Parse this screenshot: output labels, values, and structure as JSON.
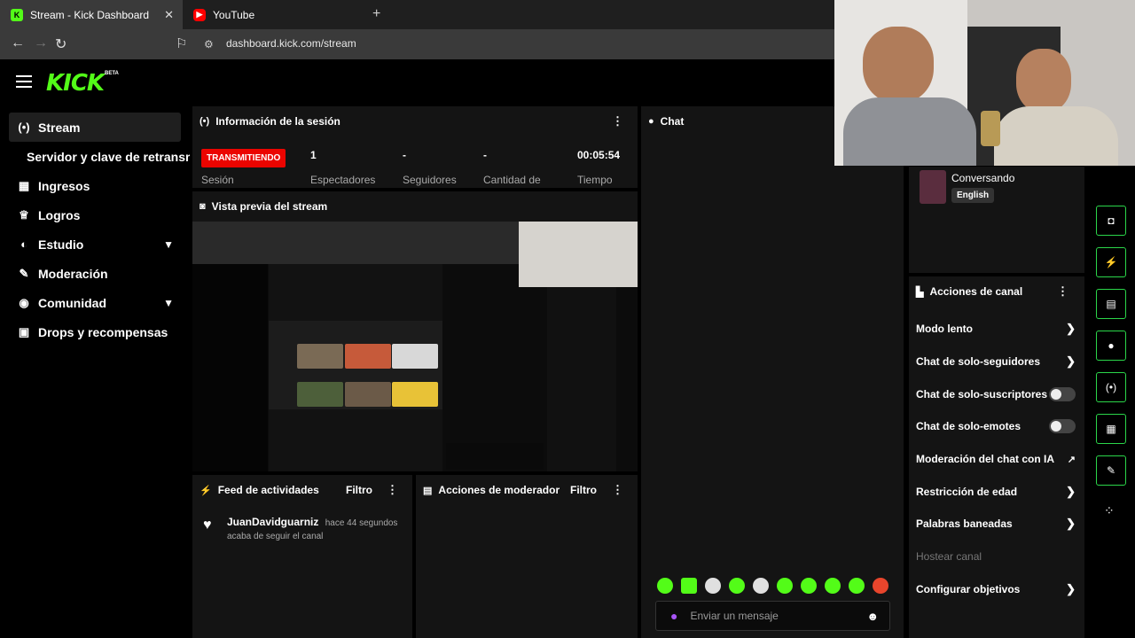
{
  "browser": {
    "tabs": [
      {
        "title": "Stream - Kick Dashboard",
        "favicon": "K",
        "favicon_color": "#53fc18"
      },
      {
        "title": "YouTube",
        "favicon": "▶",
        "favicon_color": "#ff0000"
      }
    ],
    "url": "dashboard.kick.com/stream"
  },
  "brand": {
    "logo": "KICK",
    "beta": "BETA",
    "accent": "#53fc18"
  },
  "sidebar": {
    "items": [
      {
        "label": "Stream",
        "icon": "broadcast-icon",
        "glyph": "(•)"
      },
      {
        "label": "Servidor y clave de retransmisión"
      },
      {
        "label": "Ingresos",
        "icon": "bank-icon",
        "glyph": "▦"
      },
      {
        "label": "Logros",
        "icon": "trophy-icon",
        "glyph": "🏆"
      },
      {
        "label": "Estudio",
        "icon": "palette-icon",
        "glyph": "◐"
      },
      {
        "label": "Moderación",
        "icon": "wrench-icon",
        "glyph": "✎"
      },
      {
        "label": "Comunidad",
        "icon": "people-icon",
        "glyph": "◉"
      },
      {
        "label": "Drops y recompensas",
        "icon": "gift-icon",
        "glyph": "▣"
      }
    ]
  },
  "session": {
    "title": "Información de la sesión",
    "badge": "TRANSMITIENDO",
    "session_label": "Sesión",
    "stats": [
      {
        "value": "1",
        "label": "Espectadores"
      },
      {
        "value": "-",
        "label": "Seguidores"
      },
      {
        "value": "-",
        "label": "Cantidad de"
      },
      {
        "value": "00:05:54",
        "label": "Tiempo"
      }
    ]
  },
  "preview": {
    "title": "Vista previa del stream"
  },
  "feed": {
    "title": "Feed de actividades",
    "filter": "Filtro",
    "entry": {
      "user": "JuanDavidguarniz",
      "time": "hace 44 segundos",
      "action": "acaba de seguir el canal"
    }
  },
  "mod_actions_panel": {
    "title": "Acciones de moderador",
    "filter": "Filtro"
  },
  "chat": {
    "title": "Chat",
    "placeholder": "Enviar un mensaje"
  },
  "stream_info": {
    "category": "Conversando",
    "language": "English"
  },
  "channel_actions": {
    "title": "Acciones de canal",
    "items": [
      {
        "label": "Modo lento",
        "control": "arrow"
      },
      {
        "label": "Chat de solo-seguidores",
        "control": "arrow"
      },
      {
        "label": "Chat de solo-suscriptores",
        "control": "toggle"
      },
      {
        "label": "Chat de solo-emotes",
        "control": "toggle"
      },
      {
        "label": "Moderación del chat con IA",
        "control": "external"
      },
      {
        "label": "Restricción de edad",
        "control": "arrow"
      },
      {
        "label": "Palabras baneadas",
        "control": "arrow"
      },
      {
        "label": "Hostear canal",
        "control": "disabled"
      },
      {
        "label": "Configurar objetivos",
        "control": "arrow"
      }
    ]
  }
}
